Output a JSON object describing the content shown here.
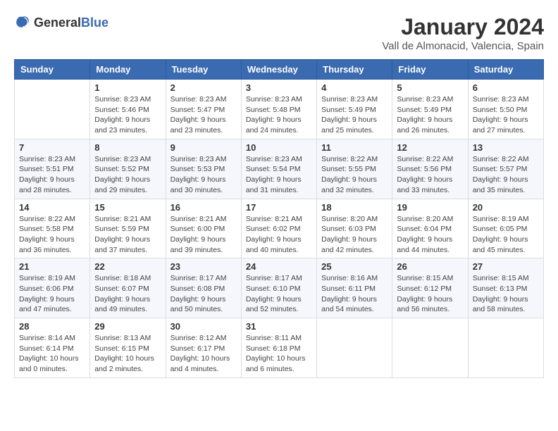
{
  "logo": {
    "general": "General",
    "blue": "Blue"
  },
  "header": {
    "month": "January 2024",
    "location": "Vall de Almonacid, Valencia, Spain"
  },
  "weekdays": [
    "Sunday",
    "Monday",
    "Tuesday",
    "Wednesday",
    "Thursday",
    "Friday",
    "Saturday"
  ],
  "weeks": [
    [
      {
        "day": null,
        "info": null
      },
      {
        "day": "1",
        "info": "Sunrise: 8:23 AM\nSunset: 5:46 PM\nDaylight: 9 hours\nand 23 minutes."
      },
      {
        "day": "2",
        "info": "Sunrise: 8:23 AM\nSunset: 5:47 PM\nDaylight: 9 hours\nand 23 minutes."
      },
      {
        "day": "3",
        "info": "Sunrise: 8:23 AM\nSunset: 5:48 PM\nDaylight: 9 hours\nand 24 minutes."
      },
      {
        "day": "4",
        "info": "Sunrise: 8:23 AM\nSunset: 5:49 PM\nDaylight: 9 hours\nand 25 minutes."
      },
      {
        "day": "5",
        "info": "Sunrise: 8:23 AM\nSunset: 5:49 PM\nDaylight: 9 hours\nand 26 minutes."
      },
      {
        "day": "6",
        "info": "Sunrise: 8:23 AM\nSunset: 5:50 PM\nDaylight: 9 hours\nand 27 minutes."
      }
    ],
    [
      {
        "day": "7",
        "info": "Sunrise: 8:23 AM\nSunset: 5:51 PM\nDaylight: 9 hours\nand 28 minutes."
      },
      {
        "day": "8",
        "info": "Sunrise: 8:23 AM\nSunset: 5:52 PM\nDaylight: 9 hours\nand 29 minutes."
      },
      {
        "day": "9",
        "info": "Sunrise: 8:23 AM\nSunset: 5:53 PM\nDaylight: 9 hours\nand 30 minutes."
      },
      {
        "day": "10",
        "info": "Sunrise: 8:23 AM\nSunset: 5:54 PM\nDaylight: 9 hours\nand 31 minutes."
      },
      {
        "day": "11",
        "info": "Sunrise: 8:22 AM\nSunset: 5:55 PM\nDaylight: 9 hours\nand 32 minutes."
      },
      {
        "day": "12",
        "info": "Sunrise: 8:22 AM\nSunset: 5:56 PM\nDaylight: 9 hours\nand 33 minutes."
      },
      {
        "day": "13",
        "info": "Sunrise: 8:22 AM\nSunset: 5:57 PM\nDaylight: 9 hours\nand 35 minutes."
      }
    ],
    [
      {
        "day": "14",
        "info": "Sunrise: 8:22 AM\nSunset: 5:58 PM\nDaylight: 9 hours\nand 36 minutes."
      },
      {
        "day": "15",
        "info": "Sunrise: 8:21 AM\nSunset: 5:59 PM\nDaylight: 9 hours\nand 37 minutes."
      },
      {
        "day": "16",
        "info": "Sunrise: 8:21 AM\nSunset: 6:00 PM\nDaylight: 9 hours\nand 39 minutes."
      },
      {
        "day": "17",
        "info": "Sunrise: 8:21 AM\nSunset: 6:02 PM\nDaylight: 9 hours\nand 40 minutes."
      },
      {
        "day": "18",
        "info": "Sunrise: 8:20 AM\nSunset: 6:03 PM\nDaylight: 9 hours\nand 42 minutes."
      },
      {
        "day": "19",
        "info": "Sunrise: 8:20 AM\nSunset: 6:04 PM\nDaylight: 9 hours\nand 44 minutes."
      },
      {
        "day": "20",
        "info": "Sunrise: 8:19 AM\nSunset: 6:05 PM\nDaylight: 9 hours\nand 45 minutes."
      }
    ],
    [
      {
        "day": "21",
        "info": "Sunrise: 8:19 AM\nSunset: 6:06 PM\nDaylight: 9 hours\nand 47 minutes."
      },
      {
        "day": "22",
        "info": "Sunrise: 8:18 AM\nSunset: 6:07 PM\nDaylight: 9 hours\nand 49 minutes."
      },
      {
        "day": "23",
        "info": "Sunrise: 8:17 AM\nSunset: 6:08 PM\nDaylight: 9 hours\nand 50 minutes."
      },
      {
        "day": "24",
        "info": "Sunrise: 8:17 AM\nSunset: 6:10 PM\nDaylight: 9 hours\nand 52 minutes."
      },
      {
        "day": "25",
        "info": "Sunrise: 8:16 AM\nSunset: 6:11 PM\nDaylight: 9 hours\nand 54 minutes."
      },
      {
        "day": "26",
        "info": "Sunrise: 8:15 AM\nSunset: 6:12 PM\nDaylight: 9 hours\nand 56 minutes."
      },
      {
        "day": "27",
        "info": "Sunrise: 8:15 AM\nSunset: 6:13 PM\nDaylight: 9 hours\nand 58 minutes."
      }
    ],
    [
      {
        "day": "28",
        "info": "Sunrise: 8:14 AM\nSunset: 6:14 PM\nDaylight: 10 hours\nand 0 minutes."
      },
      {
        "day": "29",
        "info": "Sunrise: 8:13 AM\nSunset: 6:15 PM\nDaylight: 10 hours\nand 2 minutes."
      },
      {
        "day": "30",
        "info": "Sunrise: 8:12 AM\nSunset: 6:17 PM\nDaylight: 10 hours\nand 4 minutes."
      },
      {
        "day": "31",
        "info": "Sunrise: 8:11 AM\nSunset: 6:18 PM\nDaylight: 10 hours\nand 6 minutes."
      },
      {
        "day": null,
        "info": null
      },
      {
        "day": null,
        "info": null
      },
      {
        "day": null,
        "info": null
      }
    ]
  ]
}
